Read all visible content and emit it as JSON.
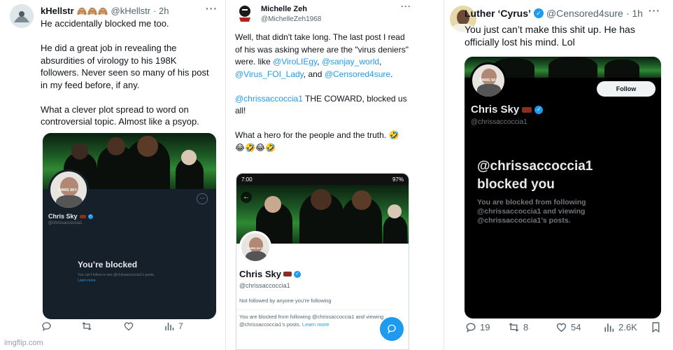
{
  "tweet1": {
    "name": "kHellstr",
    "name_emoji": "🙈🙈🙈",
    "handle": "@kHellstr",
    "time": "· 2h",
    "more": "···",
    "lines": [
      "He accidentally blocked me too.",
      "",
      "He did a great job in revealing the",
      "absurdities of virology to his 198K",
      "followers. Never seen so many of his post",
      "in my feed before, if any.",
      "",
      "What a clever plot spread to word on",
      "controversial topic. Almost like a psyop."
    ],
    "card": {
      "avatar_caption": "CHRIS SKY",
      "profile_name": "Chris Sky",
      "profile_handle": "@chrissaccoccia1",
      "blocked_title": "You’re blocked",
      "blocked_desc": "You can’t follow or see @chrissaccoccia1’s posts.",
      "learn_more": "Learn more"
    },
    "stats": {
      "views": "7"
    }
  },
  "tweet2": {
    "name": "Michelle Zeh",
    "handle": "@MichelleZeh1968",
    "more": "···",
    "text_intro": "Well, that didn't take long. The last post I read of his was asking where are the \"virus deniers\" were. like ",
    "mention1": "@ViroLIEgy",
    "mention2": "@sanjay_world",
    "mention3": "@Virus_FOI_Lady",
    "and": ", and",
    "mention4": "@Censored4sure",
    "mention5": "@chrissaccoccia1",
    "text_coward": " THE COWARD, blocked us all!",
    "text_hero": "What a hero for the people and the truth. 🤣",
    "text_emojis": "😂🤣😂🤣",
    "phone": {
      "time": "7:00",
      "battery": "97%",
      "avatar_caption": "CHRIS SKY",
      "profile_name": "Chris Sky",
      "profile_handle": "@chrissaccoccia1",
      "not_followed": "Not followed by anyone you're following",
      "blocked_msg": "You are blocked from following @chrissaccoccia1 and viewing @chrissaccoccia1's posts.",
      "learn_more": "Learn more"
    }
  },
  "tweet3": {
    "name": "Luther ‘Cyrus’",
    "handle": "@Censored4sure",
    "time": "· 1h",
    "more": "···",
    "text_line1": "You just can’t make this shit up. He has",
    "text_line2": "officially lost his mind. Lol",
    "card": {
      "avatar_caption": "CHRIS SKY",
      "follow_button": "Follow",
      "profile_name": "Chris Sky",
      "profile_handle": "@chrissaccoccia1",
      "blocked_handle": "@chrissaccoccia1",
      "blocked_title": "blocked you",
      "blocked_desc_1": "You are blocked from following",
      "blocked_desc_2": "@chrissaccoccia1 and viewing",
      "blocked_desc_3": "@chrissaccoccia1’s posts."
    },
    "stats": {
      "replies": "19",
      "reposts": "8",
      "likes": "54",
      "views": "2.6K"
    }
  },
  "watermark": "imgflip.com",
  "colors": {
    "link": "#1d9bf0",
    "muted": "#536471",
    "dark_card": "#15202b",
    "black_card": "#000000"
  }
}
